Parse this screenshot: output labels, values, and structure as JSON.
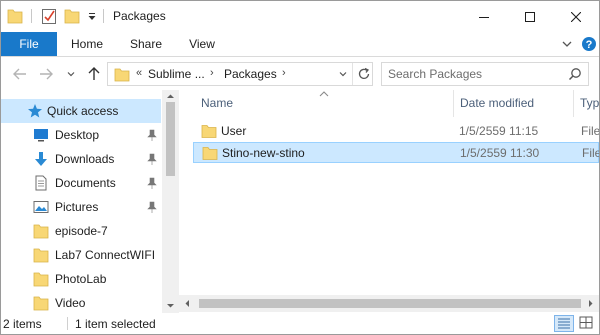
{
  "window": {
    "title": "Packages",
    "controls": {
      "minimize": "–",
      "maximize": "☐",
      "close": "✕"
    }
  },
  "ribbon": {
    "tabs": [
      {
        "label": "File",
        "active": true
      },
      {
        "label": "Home"
      },
      {
        "label": "Share"
      },
      {
        "label": "View"
      }
    ]
  },
  "address": {
    "overflow_chevron": "«",
    "segments": [
      "Sublime ...",
      "Packages"
    ],
    "separator": "›"
  },
  "search": {
    "placeholder": "Search Packages"
  },
  "nav": {
    "items": [
      {
        "label": "Quick access",
        "icon": "star-icon",
        "pinned": false,
        "selected": true
      },
      {
        "label": "Desktop",
        "icon": "desktop-icon",
        "pinned": true
      },
      {
        "label": "Downloads",
        "icon": "download-arrow-icon",
        "pinned": true
      },
      {
        "label": "Documents",
        "icon": "document-icon",
        "pinned": true
      },
      {
        "label": "Pictures",
        "icon": "pictures-icon",
        "pinned": true
      },
      {
        "label": "episode-7",
        "icon": "folder-icon",
        "pinned": false
      },
      {
        "label": "Lab7 ConnectWIFI",
        "icon": "folder-icon",
        "pinned": false
      },
      {
        "label": "PhotoLab",
        "icon": "folder-icon",
        "pinned": false
      },
      {
        "label": "Video",
        "icon": "folder-icon",
        "pinned": false
      }
    ]
  },
  "content": {
    "columns": {
      "name": "Name",
      "date": "Date modified",
      "type": "Typ"
    },
    "rows": [
      {
        "name": "User",
        "date": "1/5/2559 11:15",
        "type": "File",
        "selected": false
      },
      {
        "name": "Stino-new-stino",
        "date": "1/5/2559 11:30",
        "type": "File",
        "selected": true
      }
    ]
  },
  "status": {
    "count": "2 items",
    "selection": "1 item selected"
  },
  "colors": {
    "accent": "#1979ca",
    "selection": "#cce8ff",
    "selection_border": "#99d1ff",
    "folder": "#f8d775"
  }
}
